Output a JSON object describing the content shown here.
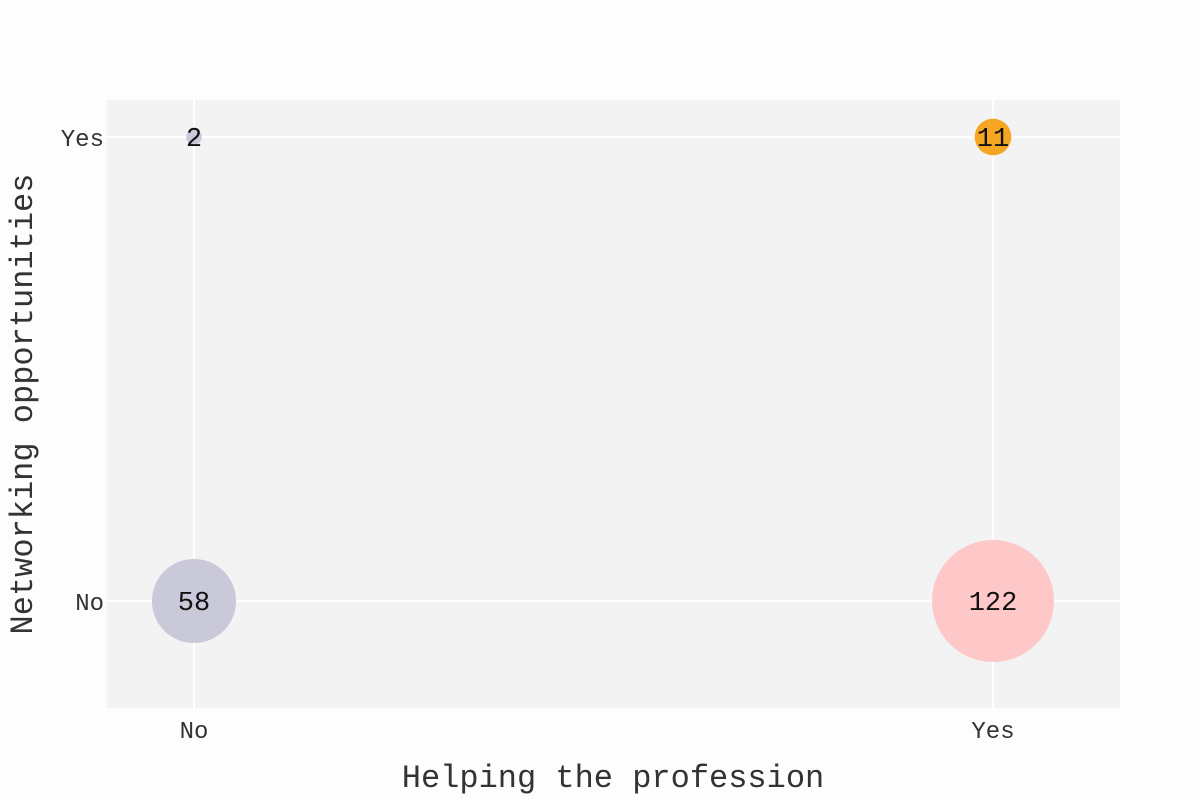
{
  "chart_data": {
    "type": "scatter",
    "title": "",
    "xlabel": "Helping the profession",
    "ylabel": "Networking opportunities",
    "x_categories": [
      "No",
      "Yes"
    ],
    "y_categories": [
      "No",
      "Yes"
    ],
    "grid": true,
    "points": [
      {
        "x": "No",
        "y": "No",
        "value": 58,
        "label": "58",
        "color": "#c9c9d9"
      },
      {
        "x": "Yes",
        "y": "No",
        "value": 122,
        "label": "122",
        "color": "#ffc8c8"
      },
      {
        "x": "No",
        "y": "Yes",
        "value": 2,
        "label": "2",
        "color": "#c9c9d9"
      },
      {
        "x": "Yes",
        "y": "Yes",
        "value": 11,
        "label": "11",
        "color": "#f5a623"
      }
    ]
  },
  "colors": {
    "page_background": "#fdfdfd",
    "plot_background": "#f3f3f3",
    "gridline": "#ffffff"
  }
}
